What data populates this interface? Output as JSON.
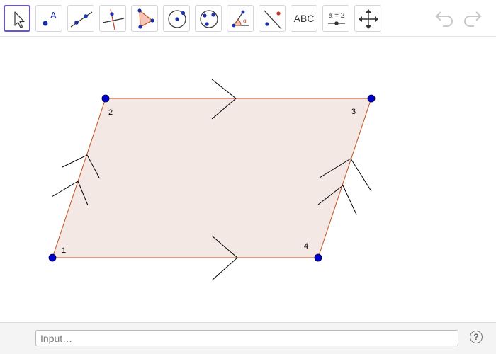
{
  "toolbar": {
    "tools": [
      {
        "name": "move",
        "icon": "cursor-arrow-icon"
      },
      {
        "name": "point",
        "icon": "point-icon",
        "glyph": "A"
      },
      {
        "name": "line",
        "icon": "line-icon"
      },
      {
        "name": "perpendicular",
        "icon": "perpendicular-line-icon"
      },
      {
        "name": "polygon",
        "icon": "polygon-icon"
      },
      {
        "name": "circle",
        "icon": "circle-with-center-icon"
      },
      {
        "name": "ellipse",
        "icon": "circle-through-points-icon"
      },
      {
        "name": "angle",
        "icon": "angle-icon",
        "glyph": "α"
      },
      {
        "name": "reflect",
        "icon": "reflect-about-line-icon"
      },
      {
        "name": "text",
        "icon": "text-icon",
        "label": "ABC"
      },
      {
        "name": "slider",
        "icon": "slider-icon",
        "label": "a = 2"
      },
      {
        "name": "move-view",
        "icon": "move-graphics-view-icon"
      }
    ],
    "selected": "move",
    "undo_icon": "undo-icon",
    "redo_icon": "redo-icon"
  },
  "figure": {
    "shape": "parallelogram",
    "fill": "#f3e8e4",
    "stroke": "#c0501f",
    "point_color": "#0000cc",
    "points": [
      {
        "id": 1,
        "label": "1"
      },
      {
        "id": 2,
        "label": "2"
      },
      {
        "id": 3,
        "label": "3"
      },
      {
        "id": 4,
        "label": "4"
      }
    ],
    "parallel_marks": {
      "top_bottom": 1,
      "left_right": 2
    }
  },
  "input_bar": {
    "placeholder": "Input…",
    "help_label": "?"
  }
}
